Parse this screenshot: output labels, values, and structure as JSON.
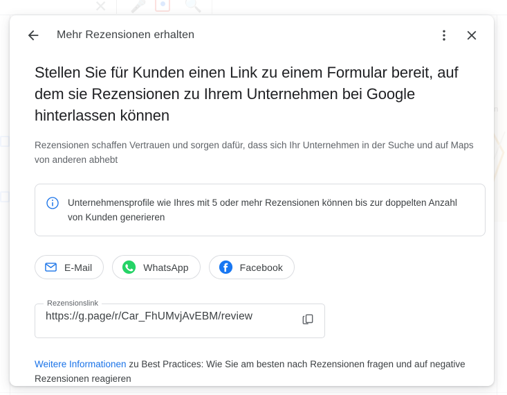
{
  "background": {
    "search_icons": [
      "close-icon",
      "microphone-icon",
      "camera-icon",
      "search-icon"
    ],
    "map_label": "nn"
  },
  "dialog": {
    "header": {
      "back_label": "←",
      "title": "Mehr Rezensionen erhalten",
      "more_label": "⋮",
      "close_label": "✕"
    },
    "headline": "Stellen Sie für Kunden einen Link zu einem Formular bereit, auf dem sie Rezensionen zu Ihrem Unternehmen bei Google hinterlassen können",
    "subtitle": "Rezensionen schaffen Vertrauen und sorgen dafür, dass sich Ihr Unternehmen in der Suche und auf Maps von anderen abhebt",
    "info_box": {
      "icon": "info-circle-icon",
      "text": "Unternehmensprofile wie Ihres mit 5 oder mehr Rezensionen können bis zur doppelten Anzahl von Kunden generieren"
    },
    "share_buttons": [
      {
        "label": "E-Mail",
        "icon": "email-icon",
        "color": "#1a73e8"
      },
      {
        "label": "WhatsApp",
        "icon": "whatsapp-icon",
        "color": "#25D366"
      },
      {
        "label": "Facebook",
        "icon": "facebook-icon",
        "color": "#1877F2"
      }
    ],
    "link_field": {
      "legend": "Rezensionslink",
      "value": "https://g.page/r/Car_FhUMvjAvEBM/review",
      "copy_icon": "copy-icon"
    },
    "footer": {
      "link_text": "Weitere Informationen",
      "rest_text": " zu Best Practices: Wie Sie am besten nach Rezensionen fragen und auf negative Rezensionen reagieren"
    }
  },
  "colors": {
    "accent": "#1a73e8",
    "text_primary": "#202124",
    "text_secondary": "#5f6368",
    "border": "#dadce0"
  }
}
